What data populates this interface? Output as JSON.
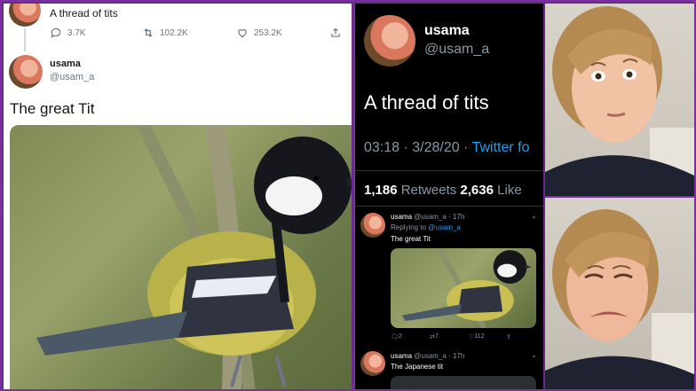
{
  "light_tweet": {
    "parent_text": "A thread of tits",
    "replies_count": "3.7K",
    "retweets_count": "102.2K",
    "likes_count": "253.2K",
    "name": "usama",
    "handle": "@usam_a",
    "text": "The great Tit"
  },
  "dark_tweet": {
    "name": "usama",
    "handle": "@usam_a",
    "text": "A thread of tits",
    "time": "03:18 · 3/28/20 · ",
    "source": "Twitter fo",
    "retweets_num": "1,186",
    "retweets_label": "Retweets",
    "likes_num": "2,636",
    "likes_label": "Like",
    "replies": [
      {
        "name": "usama",
        "meta": "@usam_a · 17h",
        "replying_prefix": "Replying to ",
        "replying_handle": "@usam_a",
        "text": "The great Tit",
        "replies": "2",
        "retweets": "7",
        "likes": "112"
      },
      {
        "name": "usama",
        "meta": "@usam_a · 17h",
        "text": "The Japanese tit"
      }
    ]
  },
  "colors": {
    "accent": "#1da1f2",
    "frame": "#7b2fa3",
    "dark_bg": "#000000",
    "muted": "#8899a6"
  }
}
